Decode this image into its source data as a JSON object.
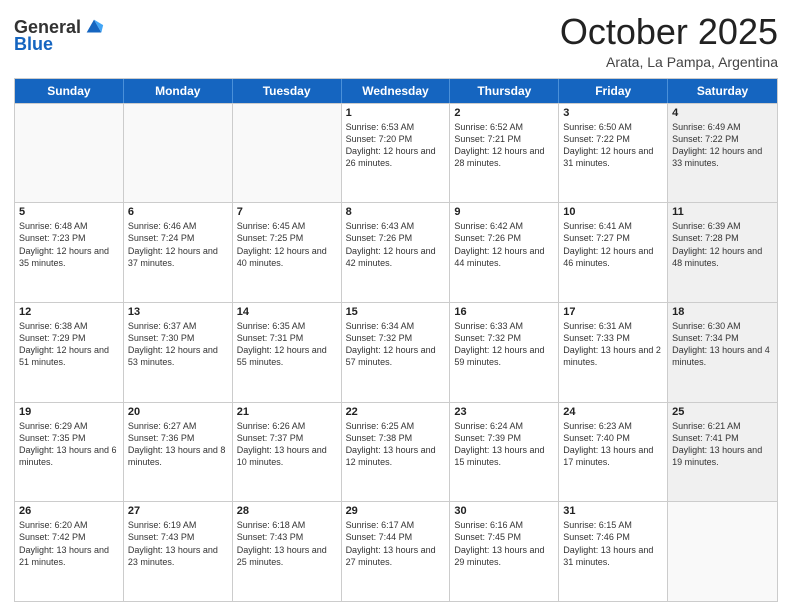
{
  "header": {
    "logo_line1": "General",
    "logo_line2": "Blue",
    "month_title": "October 2025",
    "location": "Arata, La Pampa, Argentina"
  },
  "weekdays": [
    "Sunday",
    "Monday",
    "Tuesday",
    "Wednesday",
    "Thursday",
    "Friday",
    "Saturday"
  ],
  "rows": [
    [
      {
        "day": "",
        "text": "",
        "empty": true
      },
      {
        "day": "",
        "text": "",
        "empty": true
      },
      {
        "day": "",
        "text": "",
        "empty": true
      },
      {
        "day": "1",
        "text": "Sunrise: 6:53 AM\nSunset: 7:20 PM\nDaylight: 12 hours and 26 minutes."
      },
      {
        "day": "2",
        "text": "Sunrise: 6:52 AM\nSunset: 7:21 PM\nDaylight: 12 hours and 28 minutes."
      },
      {
        "day": "3",
        "text": "Sunrise: 6:50 AM\nSunset: 7:22 PM\nDaylight: 12 hours and 31 minutes."
      },
      {
        "day": "4",
        "text": "Sunrise: 6:49 AM\nSunset: 7:22 PM\nDaylight: 12 hours and 33 minutes.",
        "shaded": true
      }
    ],
    [
      {
        "day": "5",
        "text": "Sunrise: 6:48 AM\nSunset: 7:23 PM\nDaylight: 12 hours and 35 minutes."
      },
      {
        "day": "6",
        "text": "Sunrise: 6:46 AM\nSunset: 7:24 PM\nDaylight: 12 hours and 37 minutes."
      },
      {
        "day": "7",
        "text": "Sunrise: 6:45 AM\nSunset: 7:25 PM\nDaylight: 12 hours and 40 minutes."
      },
      {
        "day": "8",
        "text": "Sunrise: 6:43 AM\nSunset: 7:26 PM\nDaylight: 12 hours and 42 minutes."
      },
      {
        "day": "9",
        "text": "Sunrise: 6:42 AM\nSunset: 7:26 PM\nDaylight: 12 hours and 44 minutes."
      },
      {
        "day": "10",
        "text": "Sunrise: 6:41 AM\nSunset: 7:27 PM\nDaylight: 12 hours and 46 minutes."
      },
      {
        "day": "11",
        "text": "Sunrise: 6:39 AM\nSunset: 7:28 PM\nDaylight: 12 hours and 48 minutes.",
        "shaded": true
      }
    ],
    [
      {
        "day": "12",
        "text": "Sunrise: 6:38 AM\nSunset: 7:29 PM\nDaylight: 12 hours and 51 minutes."
      },
      {
        "day": "13",
        "text": "Sunrise: 6:37 AM\nSunset: 7:30 PM\nDaylight: 12 hours and 53 minutes."
      },
      {
        "day": "14",
        "text": "Sunrise: 6:35 AM\nSunset: 7:31 PM\nDaylight: 12 hours and 55 minutes."
      },
      {
        "day": "15",
        "text": "Sunrise: 6:34 AM\nSunset: 7:32 PM\nDaylight: 12 hours and 57 minutes."
      },
      {
        "day": "16",
        "text": "Sunrise: 6:33 AM\nSunset: 7:32 PM\nDaylight: 12 hours and 59 minutes."
      },
      {
        "day": "17",
        "text": "Sunrise: 6:31 AM\nSunset: 7:33 PM\nDaylight: 13 hours and 2 minutes."
      },
      {
        "day": "18",
        "text": "Sunrise: 6:30 AM\nSunset: 7:34 PM\nDaylight: 13 hours and 4 minutes.",
        "shaded": true
      }
    ],
    [
      {
        "day": "19",
        "text": "Sunrise: 6:29 AM\nSunset: 7:35 PM\nDaylight: 13 hours and 6 minutes."
      },
      {
        "day": "20",
        "text": "Sunrise: 6:27 AM\nSunset: 7:36 PM\nDaylight: 13 hours and 8 minutes."
      },
      {
        "day": "21",
        "text": "Sunrise: 6:26 AM\nSunset: 7:37 PM\nDaylight: 13 hours and 10 minutes."
      },
      {
        "day": "22",
        "text": "Sunrise: 6:25 AM\nSunset: 7:38 PM\nDaylight: 13 hours and 12 minutes."
      },
      {
        "day": "23",
        "text": "Sunrise: 6:24 AM\nSunset: 7:39 PM\nDaylight: 13 hours and 15 minutes."
      },
      {
        "day": "24",
        "text": "Sunrise: 6:23 AM\nSunset: 7:40 PM\nDaylight: 13 hours and 17 minutes."
      },
      {
        "day": "25",
        "text": "Sunrise: 6:21 AM\nSunset: 7:41 PM\nDaylight: 13 hours and 19 minutes.",
        "shaded": true
      }
    ],
    [
      {
        "day": "26",
        "text": "Sunrise: 6:20 AM\nSunset: 7:42 PM\nDaylight: 13 hours and 21 minutes."
      },
      {
        "day": "27",
        "text": "Sunrise: 6:19 AM\nSunset: 7:43 PM\nDaylight: 13 hours and 23 minutes."
      },
      {
        "day": "28",
        "text": "Sunrise: 6:18 AM\nSunset: 7:43 PM\nDaylight: 13 hours and 25 minutes."
      },
      {
        "day": "29",
        "text": "Sunrise: 6:17 AM\nSunset: 7:44 PM\nDaylight: 13 hours and 27 minutes."
      },
      {
        "day": "30",
        "text": "Sunrise: 6:16 AM\nSunset: 7:45 PM\nDaylight: 13 hours and 29 minutes."
      },
      {
        "day": "31",
        "text": "Sunrise: 6:15 AM\nSunset: 7:46 PM\nDaylight: 13 hours and 31 minutes."
      },
      {
        "day": "",
        "text": "",
        "empty": true
      }
    ]
  ]
}
